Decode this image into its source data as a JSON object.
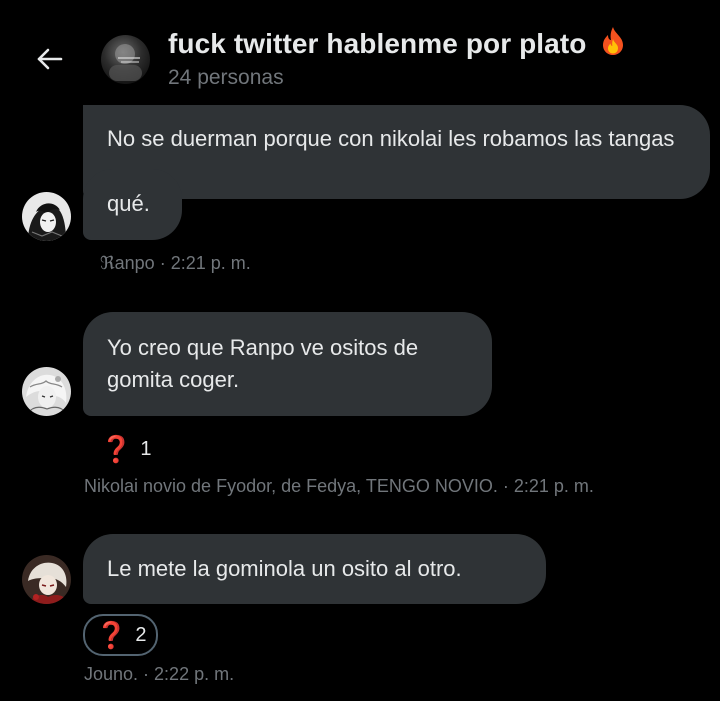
{
  "header": {
    "title": "fuck twitter hablenme por plato",
    "title_emoji": "fire-icon",
    "subtitle": "24 personas"
  },
  "messages": [
    {
      "text": "No se duerman porque con nikolai les robamos las tangas",
      "text2": "qué.",
      "meta": "ℜanpo · 2:21 p. m.",
      "avatar": "avatar-ranpo"
    },
    {
      "text": "Yo creo que Ranpo ve ositos de gomita coger.",
      "reaction_icon": "question-mark-icon",
      "reaction_count": "1",
      "meta": "Nikolai novio de Fyodor, de Fedya, TENGO NOVIO. · 2:21 p. m.",
      "avatar": "avatar-nikolai"
    },
    {
      "text": "Le mete la gominola un osito al otro.",
      "reaction_icon": "question-mark-icon",
      "reaction_count": "2",
      "meta": "Jouno. · 2:22 p. m.",
      "avatar": "avatar-jouno"
    }
  ],
  "colors": {
    "background": "#000000",
    "bubble": "#2f3336",
    "meta_text": "#71767b",
    "reaction_red": "#e0203a"
  }
}
